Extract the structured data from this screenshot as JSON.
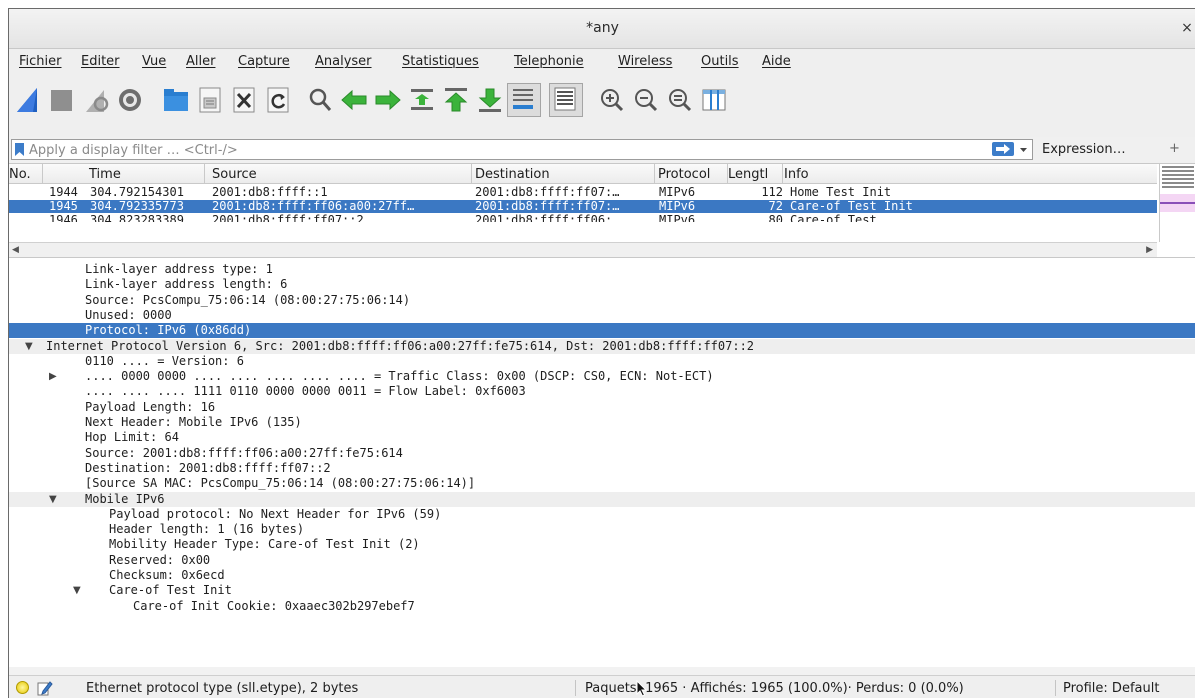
{
  "window": {
    "title": "*any",
    "close": "×"
  },
  "menu": [
    "Fichier",
    "Editer",
    "Vue",
    "Aller",
    "Capture",
    "Analyser",
    "Statistiques",
    "Telephonie",
    "Wireless",
    "Outils",
    "Aide"
  ],
  "toolbar_icons": [
    "start-capture-icon",
    "stop-capture-icon",
    "restart-capture-icon",
    "capture-options-icon",
    "open-file-icon",
    "save-file-icon",
    "close-file-icon",
    "reload-file-icon",
    "find-packet-icon",
    "go-back-icon",
    "go-forward-icon",
    "go-to-packet-icon",
    "first-packet-icon",
    "last-packet-icon",
    "auto-scroll-icon",
    "colorize-icon",
    "zoom-in-icon",
    "zoom-out-icon",
    "normal-size-icon",
    "resize-columns-icon"
  ],
  "filter": {
    "placeholder": "Apply a display filter … <Ctrl-/>",
    "expression": "Expression…",
    "plus": "+"
  },
  "packet_list": {
    "columns": [
      "No.",
      "Time",
      "Source",
      "Destination",
      "Protocol",
      "Lengtl",
      "Info"
    ],
    "rows": [
      {
        "no": "1944",
        "time": "304.792154301",
        "source": "2001:db8:ffff::1",
        "destination": "2001:db8:ffff:ff07:…",
        "protocol": "MIPv6",
        "length": "112",
        "info": "Home Test Init",
        "selected": false
      },
      {
        "no": "1945",
        "time": "304.792335773",
        "source": "2001:db8:ffff:ff06:a00:27ff…",
        "destination": "2001:db8:ffff:ff07:…",
        "protocol": "MIPv6",
        "length": "72",
        "info": "Care-of Test Init",
        "selected": true
      },
      {
        "no": "1946",
        "time": "304.823283389",
        "source": "2001:db8:ffff:ff07::2",
        "destination": "2001:db8:ffff:ff06:…",
        "protocol": "MIPv6",
        "length": "80",
        "info": "Care-of Test",
        "selected": false
      }
    ]
  },
  "details": [
    {
      "text": "Link-layer address type: 1",
      "indent": 2,
      "toggle": "",
      "style": ""
    },
    {
      "text": "Link-layer address length: 6",
      "indent": 2,
      "toggle": "",
      "style": ""
    },
    {
      "text": "Source: PcsCompu_75:06:14 (08:00:27:75:06:14)",
      "indent": 2,
      "toggle": "",
      "style": ""
    },
    {
      "text": "Unused: 0000",
      "indent": 2,
      "toggle": "",
      "style": ""
    },
    {
      "text": "Protocol: IPv6 (0x86dd)",
      "indent": 2,
      "toggle": "",
      "style": "sel"
    },
    {
      "text": "Internet Protocol Version 6, Src: 2001:db8:ffff:ff06:a00:27ff:fe75:614, Dst: 2001:db8:ffff:ff07::2",
      "indent": 0,
      "toggle": "▼",
      "style": "grp"
    },
    {
      "text": "0110 .... = Version: 6",
      "indent": 2,
      "toggle": "",
      "style": ""
    },
    {
      "text": ".... 0000 0000 .... .... .... .... .... = Traffic Class: 0x00 (DSCP: CS0, ECN: Not-ECT)",
      "indent": 2,
      "toggle": "▶",
      "style": ""
    },
    {
      "text": ".... .... .... 1111 0110 0000 0000 0011 = Flow Label: 0xf6003",
      "indent": 2,
      "toggle": "",
      "style": ""
    },
    {
      "text": "Payload Length: 16",
      "indent": 2,
      "toggle": "",
      "style": ""
    },
    {
      "text": "Next Header: Mobile IPv6 (135)",
      "indent": 2,
      "toggle": "",
      "style": ""
    },
    {
      "text": "Hop Limit: 64",
      "indent": 2,
      "toggle": "",
      "style": ""
    },
    {
      "text": "Source: 2001:db8:ffff:ff06:a00:27ff:fe75:614",
      "indent": 2,
      "toggle": "",
      "style": ""
    },
    {
      "text": "Destination: 2001:db8:ffff:ff07::2",
      "indent": 2,
      "toggle": "",
      "style": ""
    },
    {
      "text": "[Source SA MAC: PcsCompu_75:06:14 (08:00:27:75:06:14)]",
      "indent": 2,
      "toggle": "",
      "style": ""
    },
    {
      "text": "Mobile IPv6",
      "indent": 2,
      "toggle": "▼",
      "style": "grp"
    },
    {
      "text": "Payload protocol: No Next Header for IPv6 (59)",
      "indent": 4,
      "toggle": "",
      "style": ""
    },
    {
      "text": "Header length: 1 (16 bytes)",
      "indent": 4,
      "toggle": "",
      "style": ""
    },
    {
      "text": "Mobility Header Type: Care-of Test Init (2)",
      "indent": 4,
      "toggle": "",
      "style": ""
    },
    {
      "text": "Reserved: 0x00",
      "indent": 4,
      "toggle": "",
      "style": ""
    },
    {
      "text": "Checksum: 0x6ecd",
      "indent": 4,
      "toggle": "",
      "style": ""
    },
    {
      "text": "Care-of Test Init",
      "indent": 4,
      "toggle": "▼",
      "style": ""
    },
    {
      "text": "Care-of Init Cookie: 0xaaec302b297ebef7",
      "indent": 6,
      "toggle": "",
      "style": ""
    }
  ],
  "status": {
    "field": "Ethernet protocol type (sll.etype), 2 bytes",
    "stats": "Paquets: 1965 · Affichés: 1965 (100.0%)· Perdus: 0 (0.0%)",
    "profile": "Profile: Default"
  },
  "colors": {
    "selection": "#3b78c3",
    "shark_fin": "#1f5fc0"
  }
}
